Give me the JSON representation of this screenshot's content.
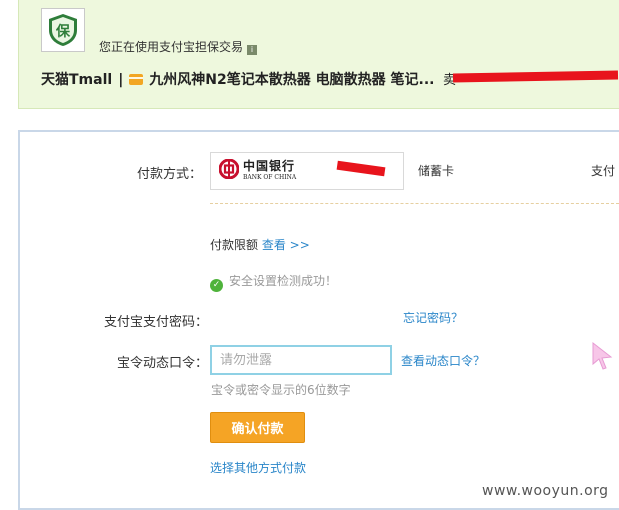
{
  "banner": {
    "escrow_text": "您正在使用支付宝担保交易",
    "shop": "天猫Tmall",
    "separator": "|",
    "product": "九州风神N2笔记本散热器 电脑散热器 笔记...",
    "seller_prefix": "卖"
  },
  "payment": {
    "method_label": "付款方式：",
    "bank_name": "中国银行",
    "bank_en": "BANK OF CHINA",
    "card_type": "储蓄卡",
    "pay_right": "支付",
    "limit_label": "付款限额",
    "limit_link": "查看 >>",
    "check_text": "安全设置检测成功！",
    "password_label": "支付宝支付密码：",
    "forgot_link": "忘记密码？",
    "token_label": "宝令动态口令：",
    "token_placeholder": "请勿泄露",
    "view_token_link": "查看动态口令？",
    "token_hint": "宝令或密令显示的6位数字",
    "confirm_button": "确认付款",
    "other_link": "选择其他方式付款"
  },
  "watermark": "www.wooyun.org",
  "colors": {
    "banner_bg": "#eef8dd",
    "link": "#2a86c9",
    "confirm_button": "#f5a425",
    "success": "#4fb33b",
    "redaction": "#e8141c"
  },
  "icons": [
    "shield-escrow-icon",
    "info-icon",
    "card-icon",
    "boc-logo-icon",
    "check-icon",
    "scroll-arrow-icon",
    "cursor-icon"
  ]
}
